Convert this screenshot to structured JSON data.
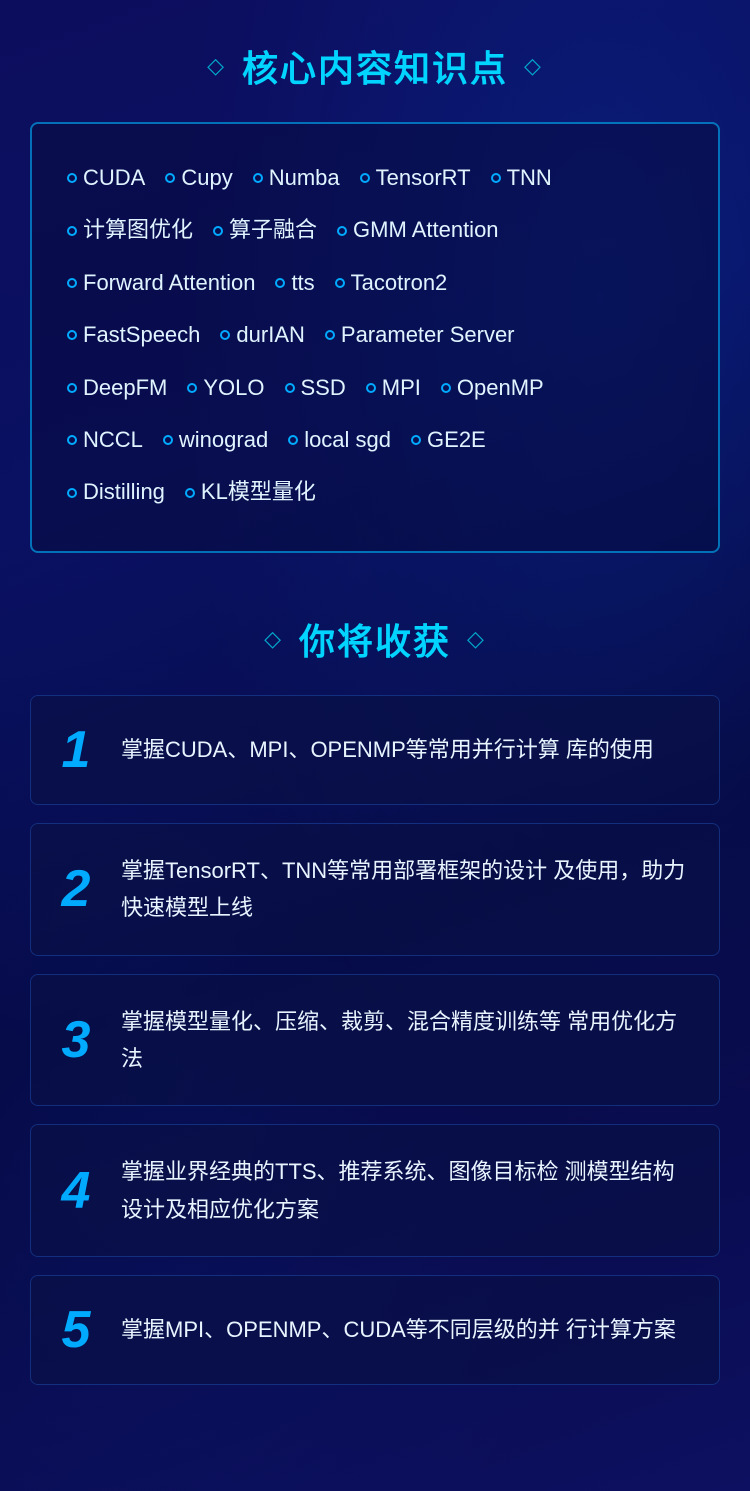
{
  "section1": {
    "title": "核心内容知识点",
    "deco_left": "◇",
    "deco_right": "◇",
    "keywords": [
      [
        "CUDA",
        "Cupy",
        "Numba",
        "TensorRT",
        "TNN"
      ],
      [
        "计算图优化",
        "算子融合",
        "GMM Attention"
      ],
      [
        "Forward Attention",
        "tts",
        "Tacotron2"
      ],
      [
        "FastSpeech",
        "durIAN",
        "Parameter Server"
      ],
      [
        "DeepFM",
        "YOLO",
        "SSD",
        "MPI",
        "OpenMP"
      ],
      [
        "NCCL",
        "winograd",
        "local sgd",
        "GE2E"
      ],
      [
        "Distilling",
        "KL模型量化"
      ]
    ]
  },
  "section2": {
    "title": "你将收获",
    "deco_left": "◇",
    "deco_right": "◇",
    "benefits": [
      {
        "number": "1",
        "text": "掌握CUDA、MPI、OPENMP等常用并行计算\n库的使用"
      },
      {
        "number": "2",
        "text": "掌握TensorRT、TNN等常用部署框架的设计\n及使用，助力快速模型上线"
      },
      {
        "number": "3",
        "text": "掌握模型量化、压缩、裁剪、混合精度训练等\n常用优化方法"
      },
      {
        "number": "4",
        "text": "掌握业界经典的TTS、推荐系统、图像目标检\n测模型结构设计及相应优化方案"
      },
      {
        "number": "5",
        "text": "掌握MPI、OPENMP、CUDA等不同层级的并\n行计算方案"
      }
    ]
  }
}
